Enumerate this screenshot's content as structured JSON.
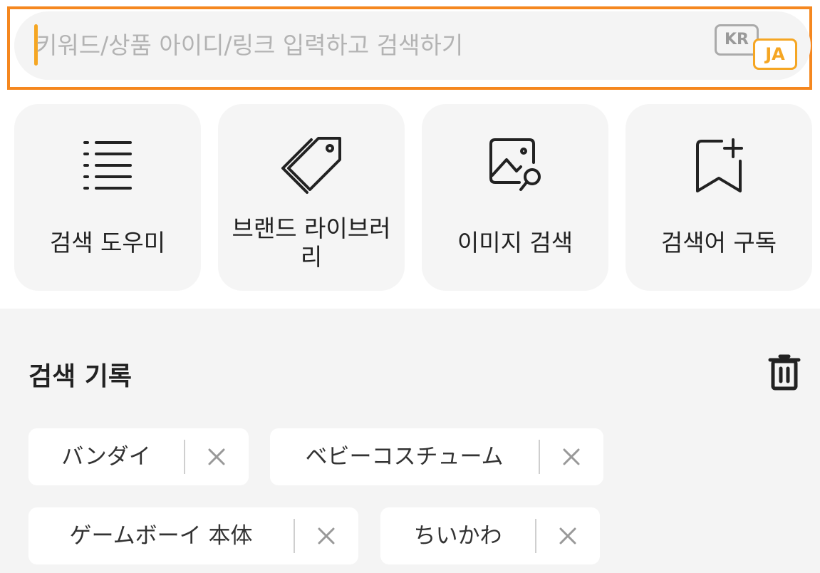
{
  "search": {
    "placeholder": "키워드/상품 아이디/링크 입력하고 검색하기",
    "value": "",
    "lang_from": "KR",
    "lang_to": "JA",
    "accent_color": "#f5871f"
  },
  "tiles": [
    {
      "label": "검색 도우미",
      "icon": "list-icon"
    },
    {
      "label": "브랜드 라이브러리",
      "icon": "tag-icon"
    },
    {
      "label": "이미지 검색",
      "icon": "image-search-icon"
    },
    {
      "label": "검색어 구독",
      "icon": "bookmark-add-icon"
    }
  ],
  "history": {
    "title": "검색 기록",
    "clear_icon": "trash-icon",
    "items": [
      {
        "text": "バンダイ"
      },
      {
        "text": "ベビーコスチューム"
      },
      {
        "text": "ゲームボーイ 本体"
      },
      {
        "text": "ちいかわ"
      }
    ]
  }
}
